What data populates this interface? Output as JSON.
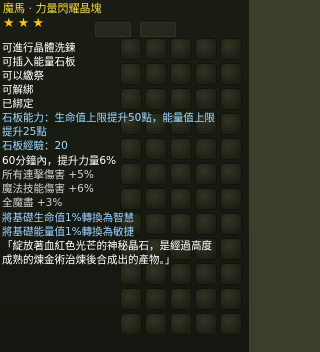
{
  "background": {
    "tabs": [
      "",
      ""
    ],
    "slot_count": 60
  },
  "tooltip": {
    "title": "魔馬 · 力量閃耀晶塊",
    "stars": 3,
    "flags": [
      "可進行晶體洗鍊",
      "可插入能量石板",
      "可以繳祭",
      "可解綁",
      "已綁定"
    ],
    "stone_effect_line1": "石板能力：生命值上限提升50點，能量值上限",
    "stone_effect_line2": "提升25點",
    "stone_exp": "石板經驗：20",
    "power_buff": "60分鐘內，提升力量6%",
    "stats": [
      "所有連擊傷害 +5%",
      "魔法技能傷害 +6%",
      "全魔盡 +3%"
    ],
    "conversions": [
      "將基礎生命值1%轉換為智慧",
      "將基礎能量值1%轉換為敏捷"
    ],
    "description_line1": "「綻放著血紅色光芒的神秘晶石，是經過高度",
    "description_line2": "成熟的煉金術治煉後合成出的產物。」"
  }
}
